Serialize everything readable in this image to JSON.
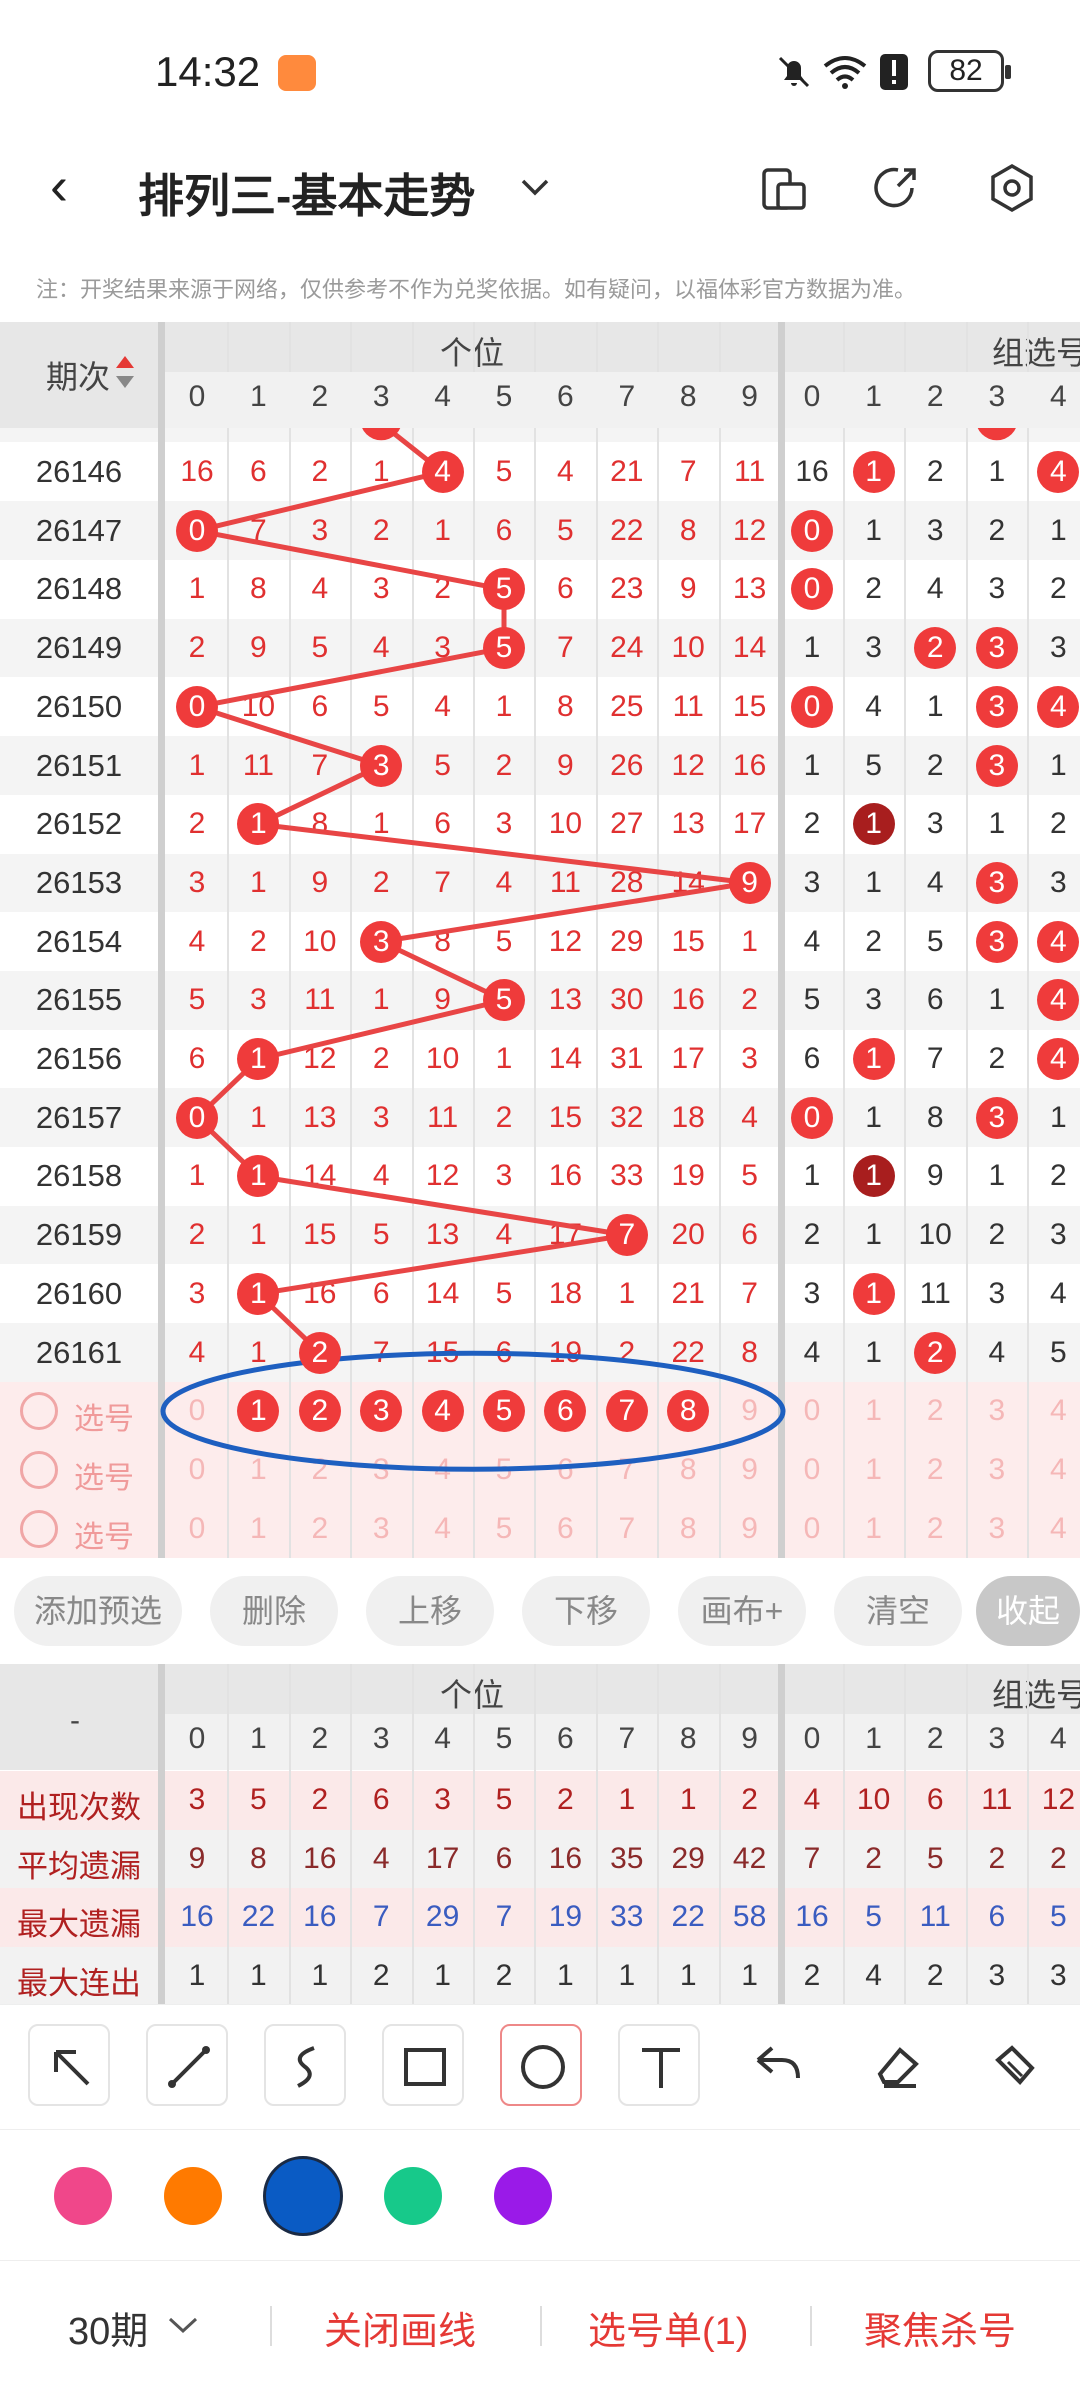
{
  "status_bar": {
    "time": "14:32",
    "battery": "82"
  },
  "header": {
    "title": "排列三-基本走势"
  },
  "note": "注：开奖结果来源于网络，仅供参考不作为兑奖依据。如有疑问，以福体彩官方数据为准。",
  "table": {
    "issue_header": "期次",
    "group1_title": "个位",
    "group2_title": "组选号",
    "digits": [
      "0",
      "1",
      "2",
      "3",
      "4",
      "5",
      "6",
      "7",
      "8",
      "9"
    ],
    "digits2": [
      "0",
      "1",
      "2",
      "3",
      "4"
    ],
    "rows": [
      {
        "issue": "26146",
        "cells": [
          "16",
          "6",
          "2",
          "1",
          "4",
          "5",
          "4",
          "21",
          "7",
          "11"
        ],
        "hit": 4,
        "cells2": [
          "16",
          "1",
          "2",
          "1",
          "4"
        ],
        "hits2": [
          1,
          4
        ],
        "dark2": []
      },
      {
        "issue": "26147",
        "cells": [
          "0",
          "7",
          "3",
          "2",
          "1",
          "6",
          "5",
          "22",
          "8",
          "12"
        ],
        "hit": 0,
        "cells2": [
          "0",
          "1",
          "3",
          "2",
          "1"
        ],
        "hits2": [
          0
        ],
        "dark2": []
      },
      {
        "issue": "26148",
        "cells": [
          "1",
          "8",
          "4",
          "3",
          "2",
          "5",
          "6",
          "23",
          "9",
          "13"
        ],
        "hit": 5,
        "cells2": [
          "0",
          "2",
          "4",
          "3",
          "2"
        ],
        "hits2": [
          0
        ],
        "dark2": []
      },
      {
        "issue": "26149",
        "cells": [
          "2",
          "9",
          "5",
          "4",
          "3",
          "5",
          "7",
          "24",
          "10",
          "14"
        ],
        "hit": 5,
        "cells2": [
          "1",
          "3",
          "2",
          "3",
          "3"
        ],
        "hits2": [
          2,
          3
        ],
        "dark2": []
      },
      {
        "issue": "26150",
        "cells": [
          "0",
          "10",
          "6",
          "5",
          "4",
          "1",
          "8",
          "25",
          "11",
          "15"
        ],
        "hit": 0,
        "cells2": [
          "0",
          "4",
          "1",
          "3",
          "4"
        ],
        "hits2": [
          0,
          3,
          4
        ],
        "dark2": []
      },
      {
        "issue": "26151",
        "cells": [
          "1",
          "11",
          "7",
          "3",
          "5",
          "2",
          "9",
          "26",
          "12",
          "16"
        ],
        "hit": 3,
        "cells2": [
          "1",
          "5",
          "2",
          "3",
          "1"
        ],
        "hits2": [
          3
        ],
        "dark2": []
      },
      {
        "issue": "26152",
        "cells": [
          "2",
          "1",
          "8",
          "1",
          "6",
          "3",
          "10",
          "27",
          "13",
          "17"
        ],
        "hit": 1,
        "cells2": [
          "2",
          "1",
          "3",
          "1",
          "2"
        ],
        "hits2": [],
        "dark2": [
          1
        ]
      },
      {
        "issue": "26153",
        "cells": [
          "3",
          "1",
          "9",
          "2",
          "7",
          "4",
          "11",
          "28",
          "14",
          "9"
        ],
        "hit": 9,
        "cells2": [
          "3",
          "1",
          "4",
          "3",
          "3"
        ],
        "hits2": [
          3
        ],
        "dark2": []
      },
      {
        "issue": "26154",
        "cells": [
          "4",
          "2",
          "10",
          "3",
          "8",
          "5",
          "12",
          "29",
          "15",
          "1"
        ],
        "hit": 3,
        "cells2": [
          "4",
          "2",
          "5",
          "3",
          "4"
        ],
        "hits2": [
          3,
          4
        ],
        "dark2": []
      },
      {
        "issue": "26155",
        "cells": [
          "5",
          "3",
          "11",
          "1",
          "9",
          "5",
          "13",
          "30",
          "16",
          "2"
        ],
        "hit": 5,
        "cells2": [
          "5",
          "3",
          "6",
          "1",
          "4"
        ],
        "hits2": [
          4
        ],
        "dark2": []
      },
      {
        "issue": "26156",
        "cells": [
          "6",
          "1",
          "12",
          "2",
          "10",
          "1",
          "14",
          "31",
          "17",
          "3"
        ],
        "hit": 1,
        "cells2": [
          "6",
          "1",
          "7",
          "2",
          "4"
        ],
        "hits2": [
          1,
          4
        ],
        "dark2": []
      },
      {
        "issue": "26157",
        "cells": [
          "0",
          "1",
          "13",
          "3",
          "11",
          "2",
          "15",
          "32",
          "18",
          "4"
        ],
        "hit": 0,
        "cells2": [
          "0",
          "1",
          "8",
          "3",
          "1"
        ],
        "hits2": [
          0,
          3
        ],
        "dark2": []
      },
      {
        "issue": "26158",
        "cells": [
          "1",
          "1",
          "14",
          "4",
          "12",
          "3",
          "16",
          "33",
          "19",
          "5"
        ],
        "hit": 1,
        "cells2": [
          "1",
          "1",
          "9",
          "1",
          "2"
        ],
        "hits2": [],
        "dark2": [
          1
        ]
      },
      {
        "issue": "26159",
        "cells": [
          "2",
          "1",
          "15",
          "5",
          "13",
          "4",
          "17",
          "7",
          "20",
          "6"
        ],
        "hit": 7,
        "cells2": [
          "2",
          "1",
          "10",
          "2",
          "3"
        ],
        "hits2": [],
        "dark2": []
      },
      {
        "issue": "26160",
        "cells": [
          "3",
          "1",
          "16",
          "6",
          "14",
          "5",
          "18",
          "1",
          "21",
          "7"
        ],
        "hit": 1,
        "cells2": [
          "3",
          "1",
          "11",
          "3",
          "4"
        ],
        "hits2": [
          1
        ],
        "dark2": []
      },
      {
        "issue": "26161",
        "cells": [
          "4",
          "1",
          "2",
          "7",
          "15",
          "6",
          "19",
          "2",
          "22",
          "8"
        ],
        "hit": 2,
        "cells2": [
          "4",
          "1",
          "2",
          "4",
          "5"
        ],
        "hits2": [
          2
        ],
        "dark2": []
      }
    ],
    "select_rows": [
      {
        "label": "选号",
        "selected": [
          1,
          2,
          3,
          4,
          5,
          6,
          7,
          8
        ]
      },
      {
        "label": "选号",
        "selected": []
      },
      {
        "label": "选号",
        "selected": []
      }
    ]
  },
  "buttons": [
    "添加预选",
    "删除",
    "上移",
    "下移",
    "画布+",
    "清空",
    "收起"
  ],
  "stats": {
    "dash": "-",
    "group1_title": "个位",
    "group2_title": "组选号",
    "rows": [
      {
        "label": "出现次数",
        "values": [
          "3",
          "5",
          "2",
          "6",
          "3",
          "5",
          "2",
          "1",
          "1",
          "2"
        ],
        "values2": [
          "4",
          "10",
          "6",
          "11",
          "12"
        ],
        "color": "#b02020"
      },
      {
        "label": "平均遗漏",
        "values": [
          "9",
          "8",
          "16",
          "4",
          "17",
          "6",
          "16",
          "35",
          "29",
          "42"
        ],
        "values2": [
          "7",
          "2",
          "5",
          "2",
          "2"
        ],
        "color": "#8a2a2a"
      },
      {
        "label": "最大遗漏",
        "values": [
          "16",
          "22",
          "16",
          "7",
          "29",
          "7",
          "19",
          "33",
          "22",
          "58"
        ],
        "values2": [
          "16",
          "5",
          "11",
          "6",
          "5"
        ],
        "color": "#3a5cc0"
      },
      {
        "label": "最大连出",
        "values": [
          "1",
          "1",
          "1",
          "2",
          "1",
          "2",
          "1",
          "1",
          "1",
          "1"
        ],
        "values2": [
          "2",
          "4",
          "2",
          "3",
          "3"
        ],
        "color": "#333"
      }
    ]
  },
  "tools": [
    "arrow-tool-icon",
    "line-tool-icon",
    "curve-tool-icon",
    "rectangle-tool-icon",
    "circle-tool-icon",
    "text-tool-icon",
    "undo-icon",
    "eraser-icon",
    "clear-brush-icon"
  ],
  "colors": [
    "#f0478a",
    "#ff7a00",
    "#0a5bc4",
    "#17c98a",
    "#9a1ae8"
  ],
  "bottom": {
    "period": "30期",
    "close_lines": "关闭画线",
    "pick_list": "选号单(1)",
    "focus_kill": "聚焦杀号"
  }
}
